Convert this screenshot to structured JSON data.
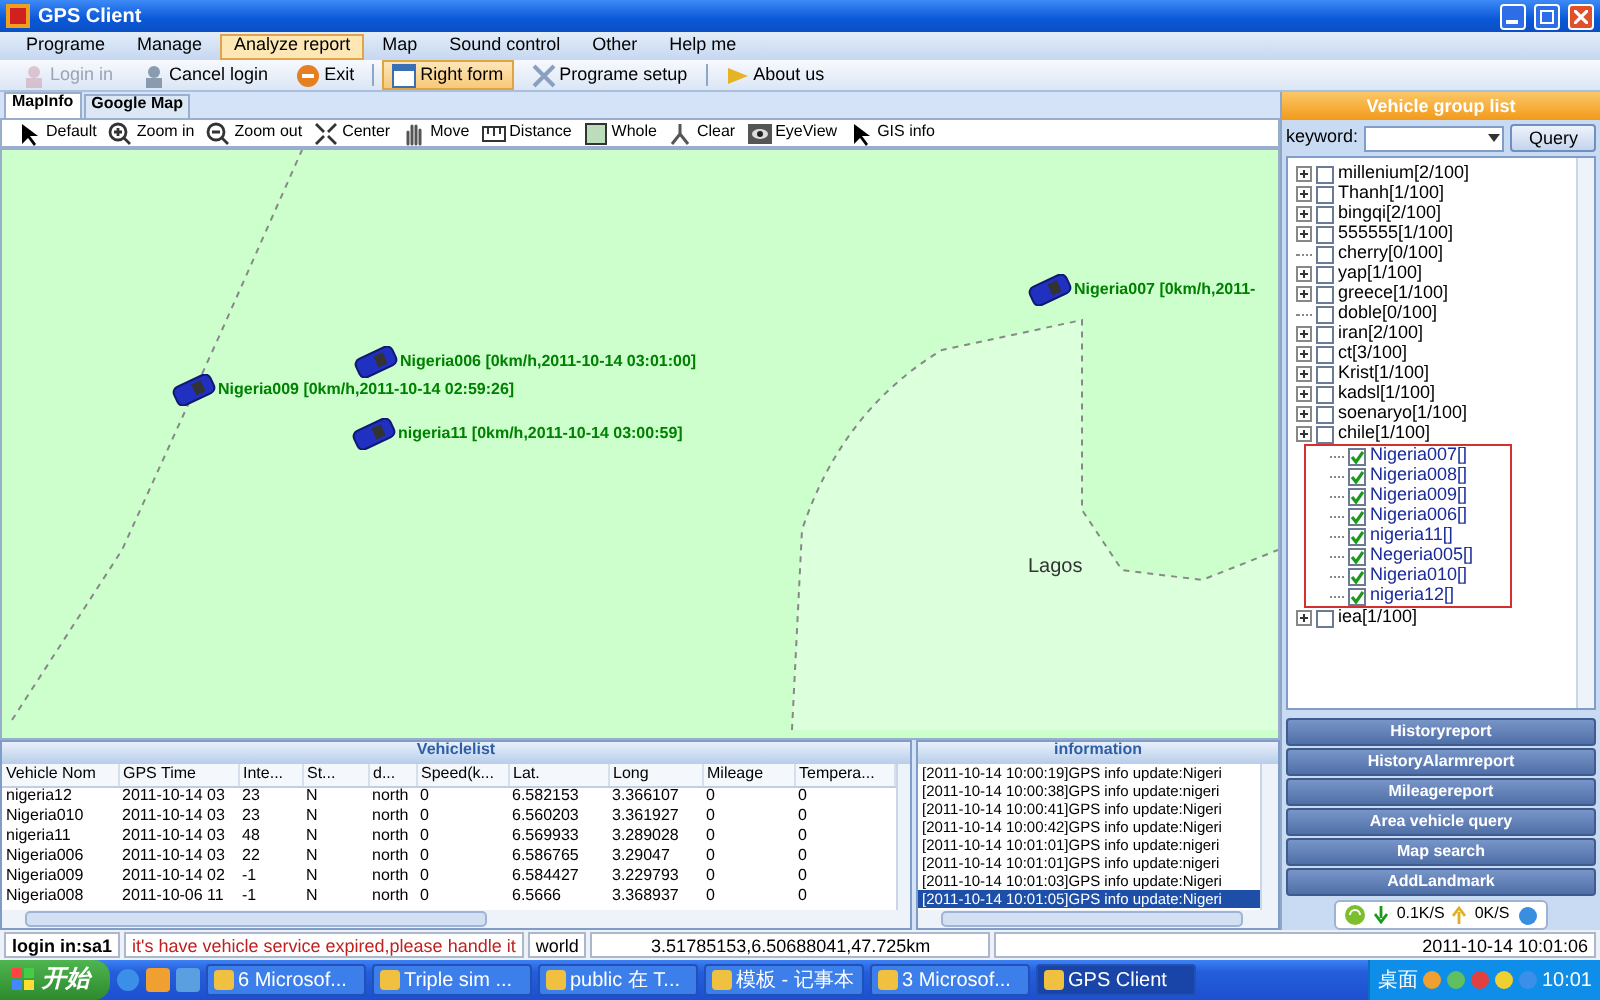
{
  "window": {
    "title": "GPS Client"
  },
  "menu": [
    {
      "label": "Programe",
      "selected": false
    },
    {
      "label": "Manage",
      "selected": false
    },
    {
      "label": "Analyze report",
      "selected": true
    },
    {
      "label": "Map",
      "selected": false
    },
    {
      "label": "Sound control",
      "selected": false
    },
    {
      "label": "Other",
      "selected": false
    },
    {
      "label": "Help me",
      "selected": false
    }
  ],
  "toolbar": [
    {
      "label": "Login in",
      "disabled": true,
      "selected": false
    },
    {
      "label": "Cancel login",
      "disabled": false,
      "selected": false
    },
    {
      "label": "Exit",
      "disabled": false,
      "selected": false
    },
    {
      "label": "Right form",
      "disabled": false,
      "selected": true
    },
    {
      "label": "Programe setup",
      "disabled": false,
      "selected": false
    },
    {
      "label": "About us",
      "disabled": false,
      "selected": false
    }
  ],
  "map_tabs": [
    {
      "label": "MapInfo",
      "selected": true
    },
    {
      "label": "Google Map",
      "selected": false
    }
  ],
  "map_tools": [
    "Default",
    "Zoom in",
    "Zoom out",
    "Center",
    "Move",
    "Distance",
    "Whole",
    "Clear",
    "EyeView",
    "GIS info"
  ],
  "map": {
    "vehicles": [
      {
        "label": "Nigeria007 [0km/h,2011-"
      },
      {
        "label": "Nigeria006 [0km/h,2011-10-14 03:01:00]"
      },
      {
        "label": "Nigeria009 [0km/h,2011-10-14 02:59:26]"
      },
      {
        "label": "nigeria11 [0km/h,2011-10-14 03:00:59]"
      }
    ],
    "places": [
      "Lagos"
    ]
  },
  "vehicle_group_list": {
    "title": "Vehicle group list",
    "keyword_label": "keyword:",
    "query_button": "Query",
    "tree": [
      {
        "label": "millenium[2/100]",
        "kind": "group",
        "checked": false
      },
      {
        "label": "Thanh[1/100]",
        "kind": "group",
        "checked": false
      },
      {
        "label": "bingqi[2/100]",
        "kind": "group",
        "checked": false
      },
      {
        "label": "555555[1/100]",
        "kind": "group",
        "checked": false
      },
      {
        "label": "cherry[0/100]",
        "kind": "empty",
        "checked": false
      },
      {
        "label": "yap[1/100]",
        "kind": "group",
        "checked": false
      },
      {
        "label": "greece[1/100]",
        "kind": "group",
        "checked": false
      },
      {
        "label": "doble[0/100]",
        "kind": "empty",
        "checked": false
      },
      {
        "label": "iran[2/100]",
        "kind": "group",
        "checked": false
      },
      {
        "label": "ct[3/100]",
        "kind": "group",
        "checked": false
      },
      {
        "label": "Krist[1/100]",
        "kind": "group",
        "checked": false
      },
      {
        "label": "kadsl[1/100]",
        "kind": "group",
        "checked": false
      },
      {
        "label": "soenaryo[1/100]",
        "kind": "group",
        "checked": false
      },
      {
        "label": "chile[1/100]",
        "kind": "group",
        "checked": false
      },
      {
        "kind": "open",
        "children": [
          {
            "label": "Nigeria007[]",
            "checked": true
          },
          {
            "label": "Nigeria008[]",
            "checked": true
          },
          {
            "label": "Nigeria009[]",
            "checked": true
          },
          {
            "label": "Nigeria006[]",
            "checked": true
          },
          {
            "label": "nigeria11[]",
            "checked": true
          },
          {
            "label": "Negeria005[]",
            "checked": true
          },
          {
            "label": "Nigeria010[]",
            "checked": true
          },
          {
            "label": "nigeria12[]",
            "checked": true
          }
        ]
      },
      {
        "label": "iea[1/100]",
        "kind": "group",
        "checked": false
      }
    ]
  },
  "report_buttons": [
    "Historyreport",
    "HistoryAlarmreport",
    "Mileagereport",
    "Area vehicle query",
    "Map search",
    "AddLandmark"
  ],
  "network": {
    "download": "0.1K/S",
    "upload": "0K/S"
  },
  "vehicle_list": {
    "title": "Vehiclelist",
    "columns": [
      "Vehicle Nom",
      "GPS Time",
      "Inte...",
      "St...",
      "d...",
      "Speed(k...",
      "Lat.",
      "Long",
      "Mileage",
      "Tempera..."
    ],
    "rows": [
      [
        "nigeria12",
        "2011-10-14 03",
        "23",
        "N",
        "north",
        "0",
        "6.582153",
        "3.366107",
        "0",
        "0"
      ],
      [
        "Nigeria010",
        "2011-10-14 03",
        "23",
        "N",
        "north",
        "0",
        "6.560203",
        "3.361927",
        "0",
        "0"
      ],
      [
        "nigeria11",
        "2011-10-14 03",
        "48",
        "N",
        "north",
        "0",
        "6.569933",
        "3.289028",
        "0",
        "0"
      ],
      [
        "Nigeria006",
        "2011-10-14 03",
        "22",
        "N",
        "north",
        "0",
        "6.586765",
        "3.29047",
        "0",
        "0"
      ],
      [
        "Nigeria009",
        "2011-10-14 02",
        "-1",
        "N",
        "north",
        "0",
        "6.584427",
        "3.229793",
        "0",
        "0"
      ],
      [
        "Nigeria008",
        "2011-10-06 11",
        "-1",
        "N",
        "north",
        "0",
        "6.5666",
        "3.368937",
        "0",
        "0"
      ]
    ]
  },
  "information": {
    "title": "information",
    "lines": [
      {
        "text": "[2011-10-14 10:00:19]GPS info update:Nigeri",
        "selected": false
      },
      {
        "text": "[2011-10-14 10:00:38]GPS info update:nigeri",
        "selected": false
      },
      {
        "text": "[2011-10-14 10:00:41]GPS info update:Nigeri",
        "selected": false
      },
      {
        "text": "[2011-10-14 10:00:42]GPS info update:Nigeri",
        "selected": false
      },
      {
        "text": "[2011-10-14 10:01:01]GPS info update:nigeri",
        "selected": false
      },
      {
        "text": "[2011-10-14 10:01:01]GPS info update:nigeri",
        "selected": false
      },
      {
        "text": "[2011-10-14 10:01:03]GPS info update:Nigeri",
        "selected": false
      },
      {
        "text": "[2011-10-14 10:01:05]GPS info update:Nigeri",
        "selected": true
      }
    ]
  },
  "status_bar": {
    "login": "login in:sa1",
    "message": "it's have vehicle service expired,please handle it",
    "map_name": "world",
    "coordinates": "3.51785153,6.50688041,47.725km",
    "datetime": "2011-10-14 10:01:06"
  },
  "taskbar": {
    "start": "开始",
    "tasks": [
      {
        "label": "6 Microsof...",
        "selected": false
      },
      {
        "label": "Triple sim ...",
        "selected": false
      },
      {
        "label": "public 在 T...",
        "selected": false
      },
      {
        "label": "模板 - 记事本",
        "selected": false
      },
      {
        "label": "3 Microsof...",
        "selected": false
      },
      {
        "label": "GPS Client",
        "selected": true
      }
    ],
    "tray_label": "桌面",
    "clock": "10:01"
  }
}
